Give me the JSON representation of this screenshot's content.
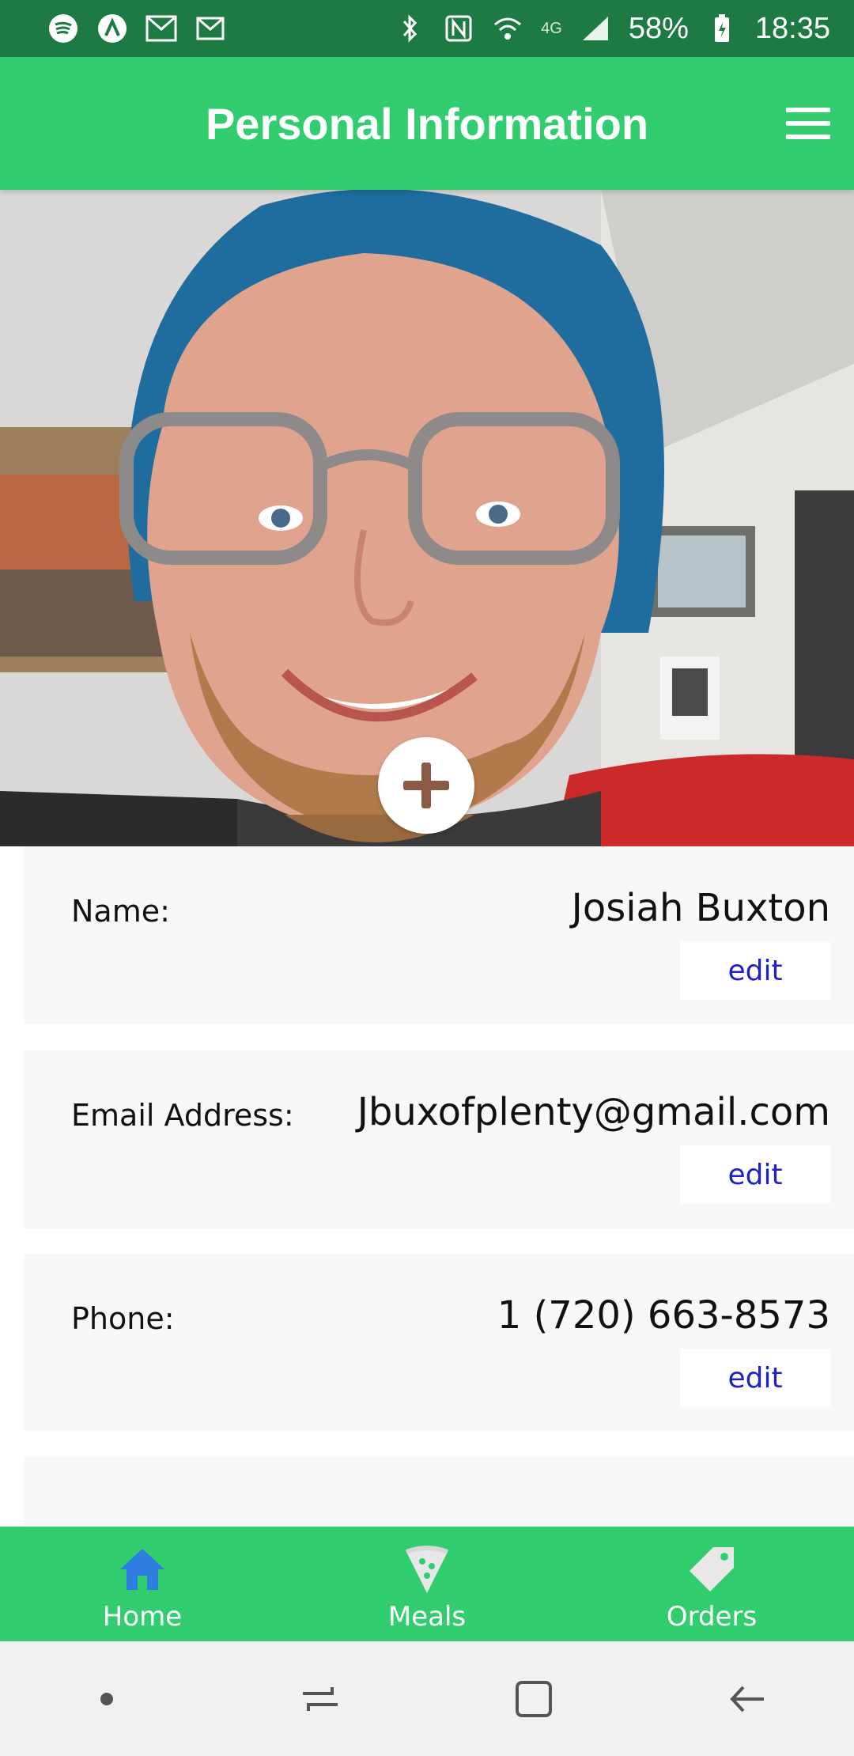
{
  "status_bar": {
    "battery": "58%",
    "time": "18:35",
    "network": "4G"
  },
  "app_bar": {
    "title": "Personal Information"
  },
  "profile": {
    "add_photo_symbol": "+"
  },
  "fields": [
    {
      "label": "Name:",
      "value": "Josiah Buxton",
      "edit_label": "edit"
    },
    {
      "label": "Email Address:",
      "value": "Jbuxofplenty@gmail.com",
      "edit_label": "edit"
    },
    {
      "label": "Phone:",
      "value": "1 (720) 663-8573",
      "edit_label": "edit"
    },
    {
      "label": "",
      "value": "",
      "edit_label": ""
    }
  ],
  "bottom_nav": {
    "items": [
      {
        "label": "Home",
        "icon": "home-icon",
        "color": "#2e7de0"
      },
      {
        "label": "Meals",
        "icon": "pizza-icon",
        "color": "#e8e8e8"
      },
      {
        "label": "Orders",
        "icon": "tag-icon",
        "color": "#e8e8e8"
      }
    ]
  },
  "colors": {
    "primary": "#31cd6f",
    "status_bar": "#1e7a43",
    "edit_text": "#2020c8",
    "card_bg": "#f8f8f8"
  }
}
